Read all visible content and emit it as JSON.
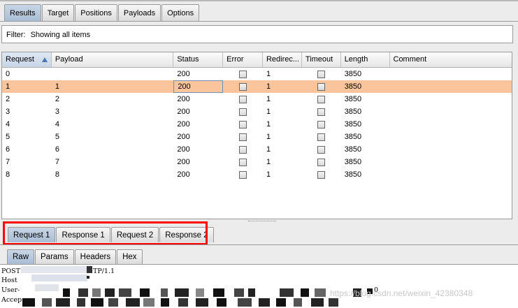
{
  "top_tabs": [
    "Results",
    "Target",
    "Positions",
    "Payloads",
    "Options"
  ],
  "filter": {
    "label": "Filter:",
    "value": "Showing all items"
  },
  "table": {
    "columns": [
      "Request",
      "Payload",
      "Status",
      "Error",
      "Redirec...",
      "Timeout",
      "Length",
      "Comment"
    ],
    "sorted_column": "Request",
    "selected_row": 1,
    "rows": [
      {
        "request": "0",
        "payload": "",
        "status": "200",
        "redirects": "1",
        "length": "3850",
        "comment": ""
      },
      {
        "request": "1",
        "payload": "1",
        "status": "200",
        "redirects": "1",
        "length": "3850",
        "comment": ""
      },
      {
        "request": "2",
        "payload": "2",
        "status": "200",
        "redirects": "1",
        "length": "3850",
        "comment": ""
      },
      {
        "request": "3",
        "payload": "3",
        "status": "200",
        "redirects": "1",
        "length": "3850",
        "comment": ""
      },
      {
        "request": "4",
        "payload": "4",
        "status": "200",
        "redirects": "1",
        "length": "3850",
        "comment": ""
      },
      {
        "request": "5",
        "payload": "5",
        "status": "200",
        "redirects": "1",
        "length": "3850",
        "comment": ""
      },
      {
        "request": "6",
        "payload": "6",
        "status": "200",
        "redirects": "1",
        "length": "3850",
        "comment": ""
      },
      {
        "request": "7",
        "payload": "7",
        "status": "200",
        "redirects": "1",
        "length": "3850",
        "comment": ""
      },
      {
        "request": "8",
        "payload": "8",
        "status": "200",
        "redirects": "1",
        "length": "3850",
        "comment": ""
      }
    ]
  },
  "request_response_tabs": [
    "Request 1",
    "Response 1",
    "Request 2",
    "Response 2"
  ],
  "view_tabs": [
    "Raw",
    "Params",
    "Headers",
    "Hex"
  ],
  "raw_lines": [
    "POST",
    "TP/1.1",
    "Host",
    "User-",
    "Accep",
    "0"
  ],
  "watermark": "https://blog.csdn.net/weixin_42380348",
  "colors": {
    "selected_row": "#fac59d",
    "active_tab": "#b4c6dc",
    "highlight_box": "#ff0000"
  }
}
